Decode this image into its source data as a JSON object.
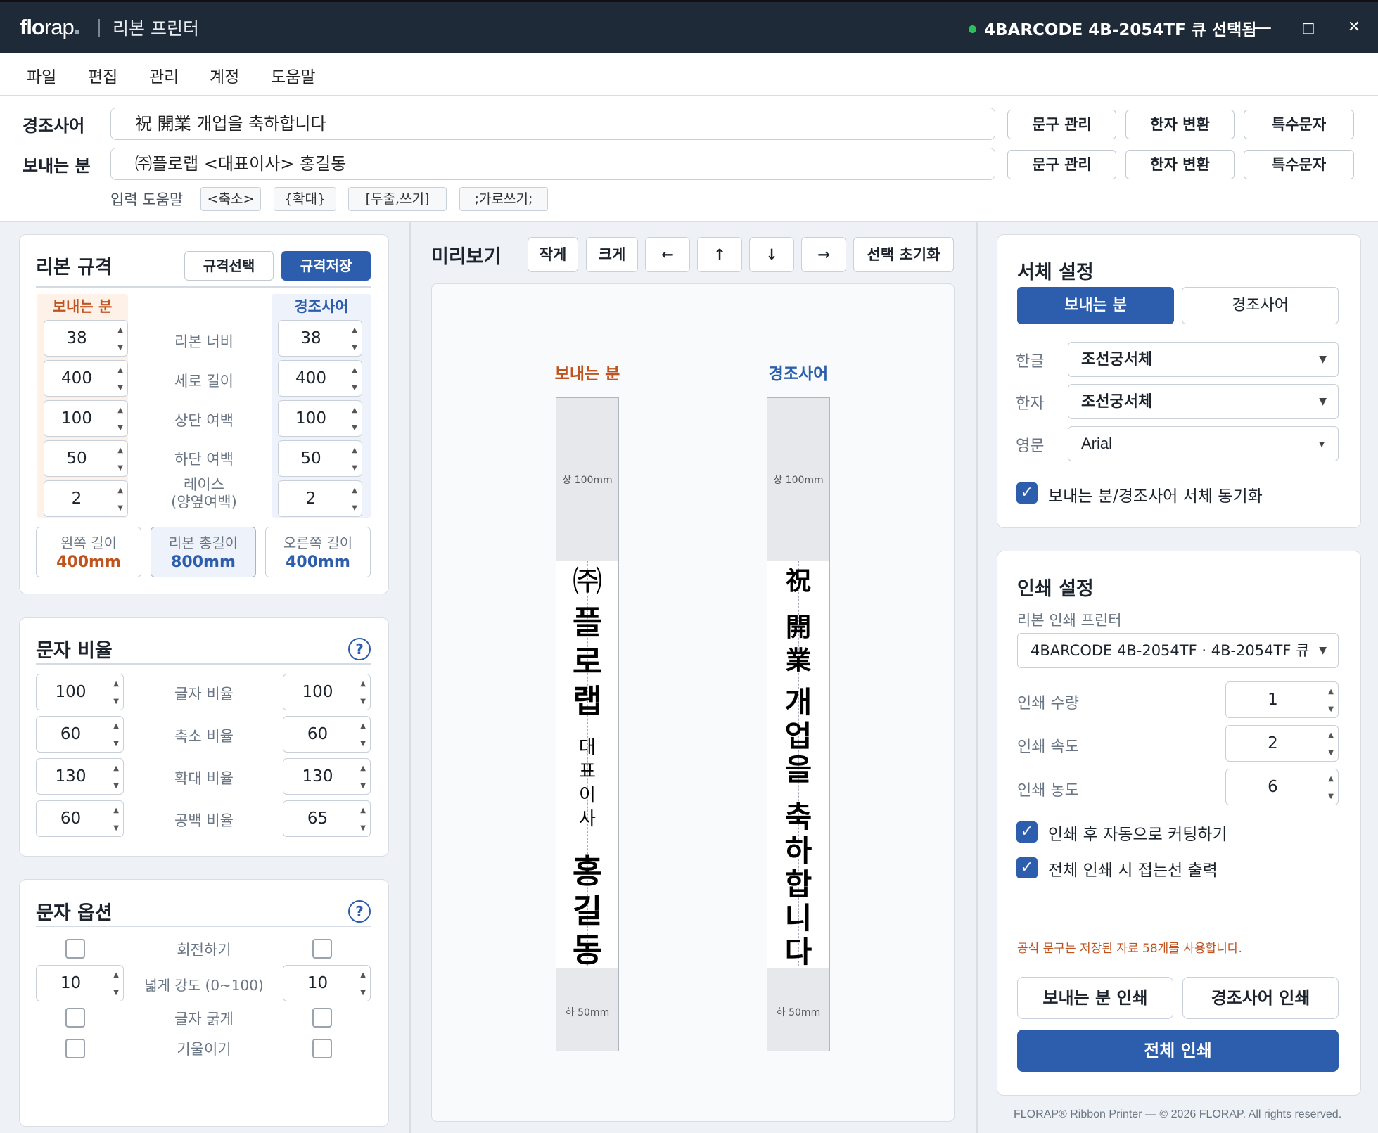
{
  "titlebar": {
    "logo_a": "flo",
    "logo_b": "rap",
    "app_title": "리본 프린터",
    "status": "4BARCODE 4B-2054TF 큐 선택됨",
    "min": "—",
    "max": "□",
    "close": "✕"
  },
  "menu": [
    "파일",
    "편집",
    "관리",
    "계정",
    "도움말"
  ],
  "inputs": {
    "greeting_label": "경조사어",
    "greeting_value": "祝 開業 개업을 축하합니다",
    "sender_label": "보내는 분",
    "sender_value": "㈜플로랩 <대표이사> 홍길동",
    "btn_phrase": "문구 관리",
    "btn_hanja": "한자 변환",
    "btn_special": "특수문자",
    "helper_label": "입력 도움말",
    "chips": [
      "<축소>",
      "{확대}",
      "[두줄,쓰기]",
      ";가로쓰기;"
    ]
  },
  "spec": {
    "title": "리본 규격",
    "btn_select": "규격선택",
    "btn_save": "규격저장",
    "col_sender": "보내는 분",
    "col_greeting": "경조사어",
    "rows": [
      {
        "label": "리본 너비",
        "sender": "38",
        "greeting": "38"
      },
      {
        "label": "세로 길이",
        "sender": "400",
        "greeting": "400"
      },
      {
        "label": "상단 여백",
        "sender": "100",
        "greeting": "100"
      },
      {
        "label": "하단 여백",
        "sender": "50",
        "greeting": "50"
      },
      {
        "label": "레이스\n(양옆여백)",
        "sender": "2",
        "greeting": "2"
      }
    ],
    "left_len_label": "왼쪽 길이",
    "left_len": "400mm",
    "total_len_label": "리본 총길이",
    "total_len": "800mm",
    "right_len_label": "오른쪽 길이",
    "right_len": "400mm"
  },
  "ratio": {
    "title": "문자 비율",
    "help": "?",
    "rows": [
      {
        "label": "글자 비율",
        "left": "100",
        "right": "100"
      },
      {
        "label": "축소 비율",
        "left": "60",
        "right": "60"
      },
      {
        "label": "확대 비율",
        "left": "130",
        "right": "130"
      },
      {
        "label": "공백 비율",
        "left": "60",
        "right": "65"
      }
    ]
  },
  "options": {
    "title": "문자 옵션",
    "help": "?",
    "rotate": "회전하기",
    "wide": "넓게 강도 (0~100)",
    "wide_left": "10",
    "wide_right": "10",
    "bold": "글자 굵게",
    "italic": "기울이기"
  },
  "preview": {
    "title": "미리보기",
    "btn_small": "작게",
    "btn_large": "크게",
    "btn_left": "←",
    "btn_up": "↑",
    "btn_down": "↓",
    "btn_right": "→",
    "btn_reset": "선택 초기화",
    "sender_head": "보내는 분",
    "greeting_head": "경조사어",
    "top_cap": "상 100mm",
    "bottom_cap": "하 50mm"
  },
  "font": {
    "title": "서체 설정",
    "tab_sender": "보내는 분",
    "tab_greeting": "경조사어",
    "hangul_label": "한글",
    "hangul_value": "조선궁서체",
    "hanja_label": "한자",
    "hanja_value": "조선궁서체",
    "english_label": "영문",
    "english_value": "Arial",
    "sync_label": "보내는 분/경조사어 서체 동기화"
  },
  "print": {
    "title": "인쇄 설정",
    "printer_label": "리본 인쇄 프린터",
    "printer_value": "4BARCODE 4B-2054TF · 4B-2054TF 큐",
    "qty_label": "인쇄 수량",
    "qty": "1",
    "speed_label": "인쇄 속도",
    "speed": "2",
    "density_label": "인쇄 농도",
    "density": "6",
    "autocut_label": "인쇄 후 자동으로 커팅하기",
    "fold_label": "전체 인쇄 시 접는선 출력",
    "notice": "공식 문구는 저장된 자료 58개를 사용합니다.",
    "btn_sender": "보내는 분 인쇄",
    "btn_greeting": "경조사어 인쇄",
    "btn_all": "전체 인쇄"
  },
  "footer": "FLORAP® Ribbon Printer — © 2026 FLORAP. All rights reserved.",
  "colors": {
    "primary": "#2c5ead",
    "sender": "#c0541f",
    "greeting": "#2c5ead",
    "titlebar": "#1f2a38",
    "notice": "#c0541f"
  }
}
